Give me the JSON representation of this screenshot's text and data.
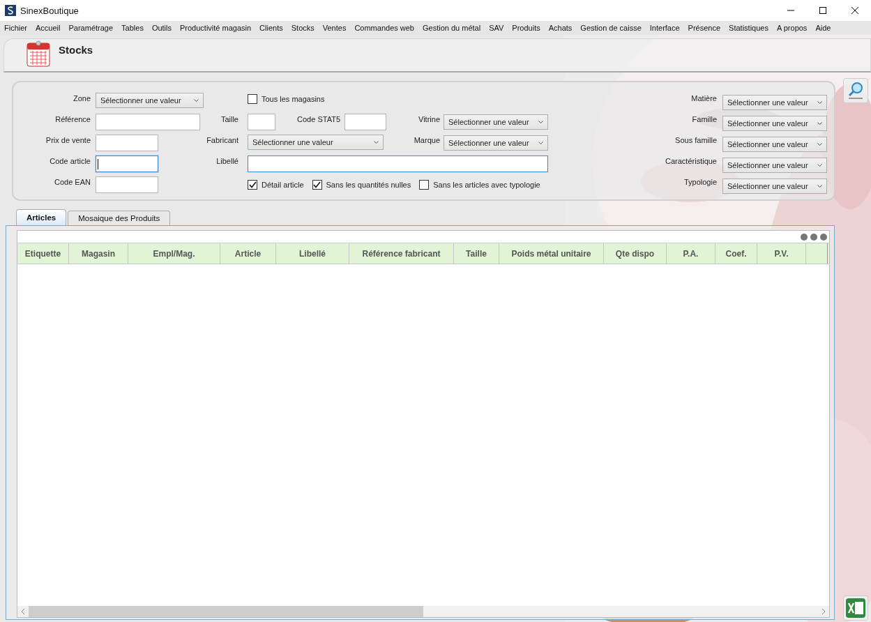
{
  "window": {
    "title": "SinexBoutique"
  },
  "menu": [
    "Fichier",
    "Accueil",
    "Paramétrage",
    "Tables",
    "Outils",
    "Productivité magasin",
    "Clients",
    "Stocks",
    "Ventes",
    "Commandes web",
    "Gestion du métal",
    "SAV",
    "Produits",
    "Achats",
    "Gestion de caisse",
    "Interface",
    "Présence",
    "Statistiques",
    "A propos",
    "Aide"
  ],
  "page": {
    "title": "Stocks"
  },
  "filters": {
    "left": [
      {
        "label": "Zone",
        "kind": "select",
        "value": "Sélectionner une valeur",
        "focused": false
      },
      {
        "label": "Référence",
        "kind": "text",
        "focused": false
      },
      {
        "label": "Prix de vente",
        "kind": "text",
        "focused": false
      },
      {
        "label": "Code article",
        "kind": "text",
        "focused": true
      },
      {
        "label": "Code EAN",
        "kind": "text",
        "focused": false
      }
    ],
    "all_stores": {
      "label": "Tous les magasins",
      "checked": false
    },
    "taille": {
      "label": "Taille"
    },
    "code_stat5": {
      "label": "Code STAT5"
    },
    "vitrine": {
      "label": "Vitrine",
      "value": "Sélectionner une valeur"
    },
    "fabricant": {
      "label": "Fabricant",
      "value": "Sélectionner une valeur"
    },
    "marque": {
      "label": "Marque",
      "value": "Sélectionner une valeur"
    },
    "libelle": {
      "label": "Libellé"
    },
    "options": [
      {
        "label": "Détail article",
        "checked": true
      },
      {
        "label": "Sans les quantités nulles",
        "checked": true
      },
      {
        "label": "Sans les articles avec typologie",
        "checked": false
      }
    ],
    "right": [
      {
        "label": "Matière",
        "value": "Sélectionner une valeur"
      },
      {
        "label": "Famille",
        "value": "Sélectionner une valeur"
      },
      {
        "label": "Sous famille",
        "value": "Sélectionner une valeur"
      },
      {
        "label": "Caractéristique",
        "value": "Sélectionner une valeur"
      },
      {
        "label": "Typologie",
        "value": "Sélectionner une valeur"
      }
    ]
  },
  "tabs": [
    {
      "label": "Articles",
      "selected": true
    },
    {
      "label": "Mosaique des Produits",
      "selected": false
    }
  ],
  "table": {
    "columns": [
      "Etiquette",
      "Magasin",
      "Empl/Mag.",
      "Article",
      "Libellé",
      "Référence fabricant",
      "Taille",
      "Poids métal unitaire",
      "Qte dispo",
      "P.A.",
      "Coef.",
      "P.V."
    ]
  }
}
